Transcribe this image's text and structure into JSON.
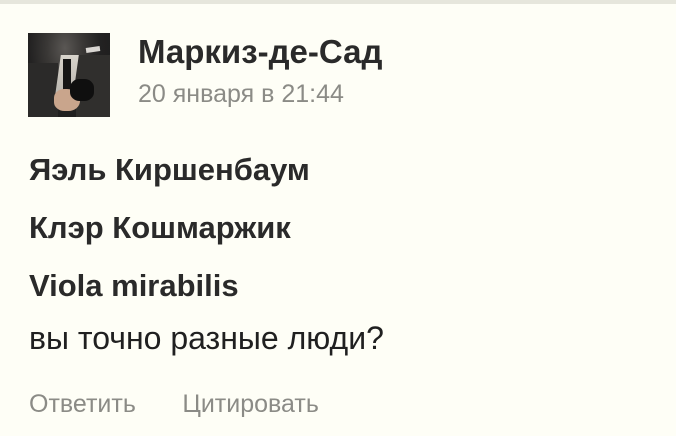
{
  "comment": {
    "author": "Маркиз-де-Сад",
    "timestamp": "20 января в 21:44",
    "mentions": [
      "Яэль Киршенбаум",
      "Клэр Кошмаржик",
      "Viola mirabilis"
    ],
    "text": "вы точно разные люди?",
    "actions": {
      "reply": "Ответить",
      "quote": "Цитировать"
    }
  }
}
